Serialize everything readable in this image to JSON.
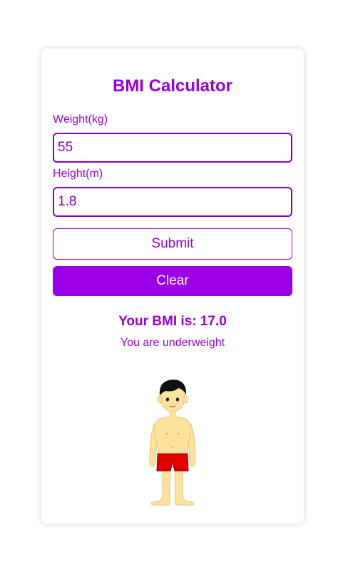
{
  "app": {
    "title": "BMI Calculator"
  },
  "form": {
    "weight_label": "Weight(kg)",
    "weight_value": "55",
    "height_label": "Height(m)",
    "height_value": "1.8",
    "submit_label": "Submit",
    "clear_label": "Clear"
  },
  "result": {
    "bmi_text": "Your BMI is: 17.0",
    "status_text": "You are underweight"
  },
  "illustration": {
    "icon": "underweight-boy-figure"
  },
  "colors": {
    "accent": "#9a00d6",
    "button_fill": "#9a00e6",
    "shorts": "#e00000",
    "skin": "#fde29e"
  }
}
